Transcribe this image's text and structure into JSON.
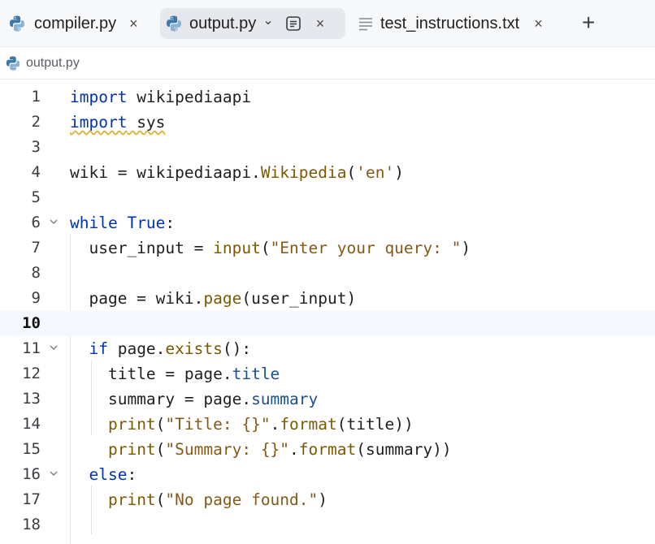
{
  "tabs": [
    {
      "label": "compiler.py",
      "icon": "python-icon",
      "active": false,
      "close": "×"
    },
    {
      "label": "output.py",
      "icon": "python-icon",
      "active": true,
      "dropdown": "⌄",
      "reader_icon": "reader-mode-icon",
      "close": "×"
    },
    {
      "label": "test_instructions.txt",
      "icon": "text-file-icon",
      "active": false,
      "close": "×"
    }
  ],
  "new_tab": "+",
  "breadcrumb": {
    "label": "output.py",
    "icon": "python-icon"
  },
  "editor": {
    "current_line": 10,
    "lines": [
      {
        "n": "1",
        "tokens": [
          [
            "kw",
            "import"
          ],
          [
            "op",
            " wikipediaapi"
          ]
        ]
      },
      {
        "n": "2",
        "tokens": [
          [
            "kw squig",
            "import"
          ],
          [
            "op squig",
            " sys"
          ]
        ]
      },
      {
        "n": "3",
        "tokens": []
      },
      {
        "n": "4",
        "tokens": [
          [
            "op",
            "wiki = wikipediaapi."
          ],
          [
            "fn",
            "Wikipedia"
          ],
          [
            "op",
            "("
          ],
          [
            "str",
            "'en'"
          ],
          [
            "op",
            ")"
          ]
        ]
      },
      {
        "n": "5",
        "tokens": []
      },
      {
        "n": "6",
        "tokens": [
          [
            "kw",
            "while"
          ],
          [
            "op",
            " "
          ],
          [
            "kw",
            "True"
          ],
          [
            "op",
            ":"
          ]
        ],
        "fold": true
      },
      {
        "n": "7",
        "tokens": [
          [
            "op",
            "  user_input = "
          ],
          [
            "fn",
            "input"
          ],
          [
            "op",
            "("
          ],
          [
            "str",
            "\"Enter your query: \""
          ],
          [
            "op",
            ")"
          ]
        ]
      },
      {
        "n": "8",
        "tokens": []
      },
      {
        "n": "9",
        "tokens": [
          [
            "op",
            "  page = wiki."
          ],
          [
            "fn",
            "page"
          ],
          [
            "op",
            "(user_input)"
          ]
        ]
      },
      {
        "n": "10",
        "tokens": []
      },
      {
        "n": "11",
        "tokens": [
          [
            "op",
            "  "
          ],
          [
            "kw",
            "if"
          ],
          [
            "op",
            " page."
          ],
          [
            "fn",
            "exists"
          ],
          [
            "op",
            "():"
          ]
        ],
        "fold": true
      },
      {
        "n": "12",
        "tokens": [
          [
            "op",
            "    title = page."
          ],
          [
            "attr",
            "title"
          ]
        ]
      },
      {
        "n": "13",
        "tokens": [
          [
            "op",
            "    summary = page."
          ],
          [
            "attr",
            "summary"
          ]
        ]
      },
      {
        "n": "14",
        "tokens": [
          [
            "op",
            "    "
          ],
          [
            "fn",
            "print"
          ],
          [
            "op",
            "("
          ],
          [
            "str",
            "\"Title: {}\""
          ],
          [
            "op",
            "."
          ],
          [
            "fn",
            "format"
          ],
          [
            "op",
            "(title))"
          ]
        ]
      },
      {
        "n": "15",
        "tokens": [
          [
            "op",
            "    "
          ],
          [
            "fn",
            "print"
          ],
          [
            "op",
            "("
          ],
          [
            "str",
            "\"Summary: {}\""
          ],
          [
            "op",
            "."
          ],
          [
            "fn",
            "format"
          ],
          [
            "op",
            "(summary))"
          ]
        ]
      },
      {
        "n": "16",
        "tokens": [
          [
            "op",
            "  "
          ],
          [
            "kw",
            "else"
          ],
          [
            "op",
            ":"
          ]
        ],
        "fold": true
      },
      {
        "n": "17",
        "tokens": [
          [
            "op",
            "    "
          ],
          [
            "fn",
            "print"
          ],
          [
            "op",
            "("
          ],
          [
            "str",
            "\"No page found.\""
          ],
          [
            "op",
            ")"
          ]
        ]
      },
      {
        "n": "18",
        "tokens": []
      }
    ]
  }
}
